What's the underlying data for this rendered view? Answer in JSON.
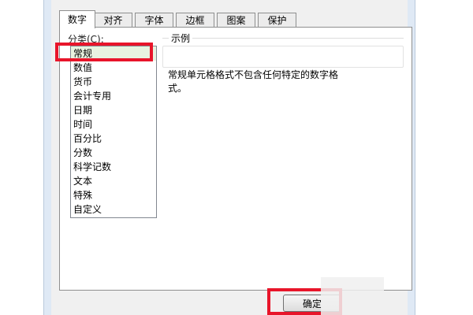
{
  "tabs": [
    {
      "label": "数字",
      "active": true
    },
    {
      "label": "对齐",
      "active": false
    },
    {
      "label": "字体",
      "active": false
    },
    {
      "label": "边框",
      "active": false
    },
    {
      "label": "图案",
      "active": false
    },
    {
      "label": "保护",
      "active": false
    }
  ],
  "category": {
    "label": "分类(C):",
    "items": [
      "常规",
      "数值",
      "货币",
      "会计专用",
      "日期",
      "时间",
      "百分比",
      "分数",
      "科学记数",
      "文本",
      "特殊",
      "自定义"
    ],
    "selected": "常规"
  },
  "sample": {
    "title": "示例",
    "value": ""
  },
  "description": "常规单元格格式不包含任何特定的数字格式。",
  "buttons": {
    "ok": "确定"
  },
  "colors": {
    "highlight": "#e8152a",
    "selected_bg": "#e8f3e0"
  }
}
